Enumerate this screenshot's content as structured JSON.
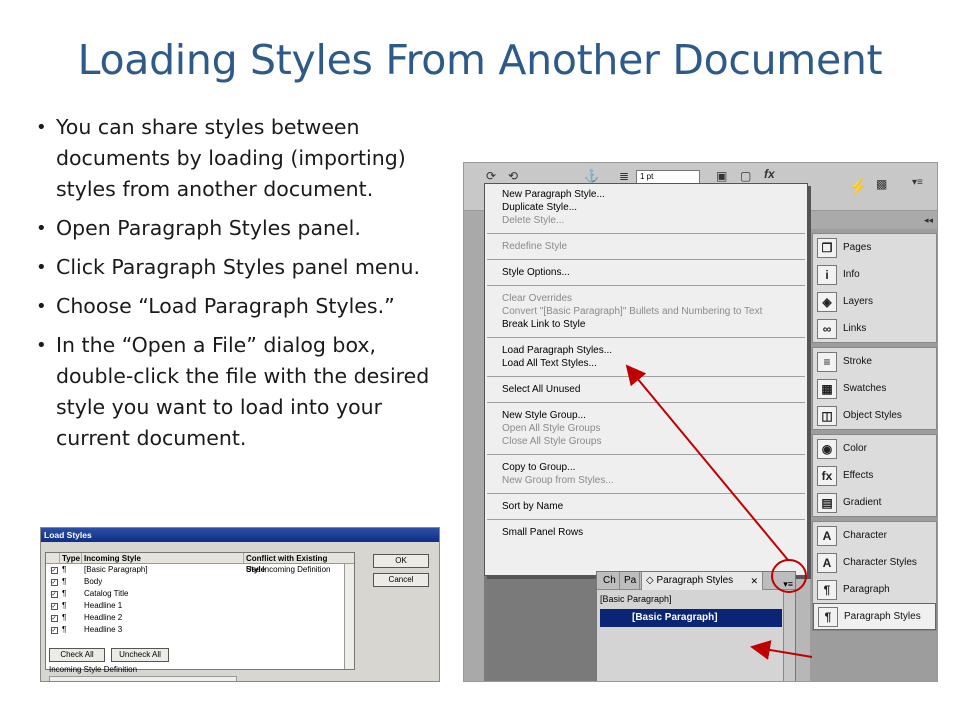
{
  "slide": {
    "title": "Loading Styles From Another Document",
    "bullets": [
      "You can share styles between documents by loading (importing) styles from another document.",
      "Open Paragraph Styles panel.",
      "Click Paragraph Styles panel menu.",
      "Choose “Load Paragraph Styles.”",
      "In the “Open a File” dialog box, double-click the file with the desired style you want to load into  your current document."
    ]
  },
  "load_styles_dialog": {
    "title": "Load Styles",
    "columns": [
      "Type",
      "Incoming Style",
      "Conflict with Existing Style"
    ],
    "rows": [
      {
        "checked": "✓",
        "type": "¶",
        "style": "[Basic Paragraph]",
        "conflict": "Use Incoming Definition"
      },
      {
        "checked": "✓",
        "type": "¶",
        "style": "Body",
        "conflict": ""
      },
      {
        "checked": "✓",
        "type": "¶",
        "style": "Catalog Title",
        "conflict": ""
      },
      {
        "checked": "✓",
        "type": "¶",
        "style": "Headline 1",
        "conflict": ""
      },
      {
        "checked": "✓",
        "type": "¶",
        "style": "Headline 2",
        "conflict": ""
      },
      {
        "checked": "✓",
        "type": "¶",
        "style": "Headline 3",
        "conflict": ""
      }
    ],
    "ok": "OK",
    "cancel": "Cancel",
    "check_all": "Check All",
    "uncheck_all": "Uncheck All",
    "definition_label": "Incoming Style Definition"
  },
  "indesign": {
    "stroke_value": "1 pt",
    "menu_items": [
      [
        {
          "label": "New Paragraph Style...",
          "enabled": true
        },
        {
          "label": "Duplicate Style...",
          "enabled": true
        },
        {
          "label": "Delete Style...",
          "enabled": false
        }
      ],
      [
        {
          "label": "Redefine Style",
          "enabled": false
        }
      ],
      [
        {
          "label": "Style Options...",
          "enabled": true
        }
      ],
      [
        {
          "label": "Clear Overrides",
          "enabled": false
        },
        {
          "label": "Convert \"[Basic Paragraph]\" Bullets and Numbering to Text",
          "enabled": false
        },
        {
          "label": "Break Link to Style",
          "enabled": true
        }
      ],
      [
        {
          "label": "Load Paragraph Styles...",
          "enabled": true
        },
        {
          "label": "Load All Text Styles...",
          "enabled": true
        }
      ],
      [
        {
          "label": "Select All Unused",
          "enabled": true
        }
      ],
      [
        {
          "label": "New Style Group...",
          "enabled": true
        },
        {
          "label": "Open All Style Groups",
          "enabled": false
        },
        {
          "label": "Close All Style Groups",
          "enabled": false
        }
      ],
      [
        {
          "label": "Copy to Group...",
          "enabled": true
        },
        {
          "label": "New Group from Styles...",
          "enabled": false
        }
      ],
      [
        {
          "label": "Sort by Name",
          "enabled": true
        }
      ],
      [
        {
          "label": "Small Panel Rows",
          "enabled": true
        }
      ]
    ],
    "panel_groups": [
      [
        {
          "label": "Pages",
          "icon": "pages-icon",
          "glyph": "❐"
        },
        {
          "label": "Info",
          "icon": "info-icon",
          "glyph": "i"
        },
        {
          "label": "Layers",
          "icon": "layers-icon",
          "glyph": "◈"
        },
        {
          "label": "Links",
          "icon": "links-icon",
          "glyph": "∞"
        }
      ],
      [
        {
          "label": "Stroke",
          "icon": "stroke-icon",
          "glyph": "≡"
        },
        {
          "label": "Swatches",
          "icon": "swatches-icon",
          "glyph": "▦"
        },
        {
          "label": "Object Styles",
          "icon": "object-styles-icon",
          "glyph": "◫"
        }
      ],
      [
        {
          "label": "Color",
          "icon": "color-icon",
          "glyph": "◉"
        },
        {
          "label": "Effects",
          "icon": "effects-icon",
          "glyph": "fx"
        },
        {
          "label": "Gradient",
          "icon": "gradient-icon",
          "glyph": "▤"
        }
      ],
      [
        {
          "label": "Character",
          "icon": "character-icon",
          "glyph": "A"
        },
        {
          "label": "Character Styles",
          "icon": "character-styles-icon",
          "glyph": "A"
        },
        {
          "label": "Paragraph",
          "icon": "paragraph-icon",
          "glyph": "¶"
        },
        {
          "label": "Paragraph Styles",
          "icon": "paragraph-styles-icon",
          "glyph": "¶",
          "active": true
        }
      ]
    ],
    "pstyles": {
      "tab1": "Ch",
      "tab2": "Pa",
      "active_tab": "◇ Paragraph Styles",
      "close": "✕",
      "current": "[Basic Paragraph]",
      "selected": "[Basic Paragraph]"
    }
  },
  "accent": "#c00000"
}
